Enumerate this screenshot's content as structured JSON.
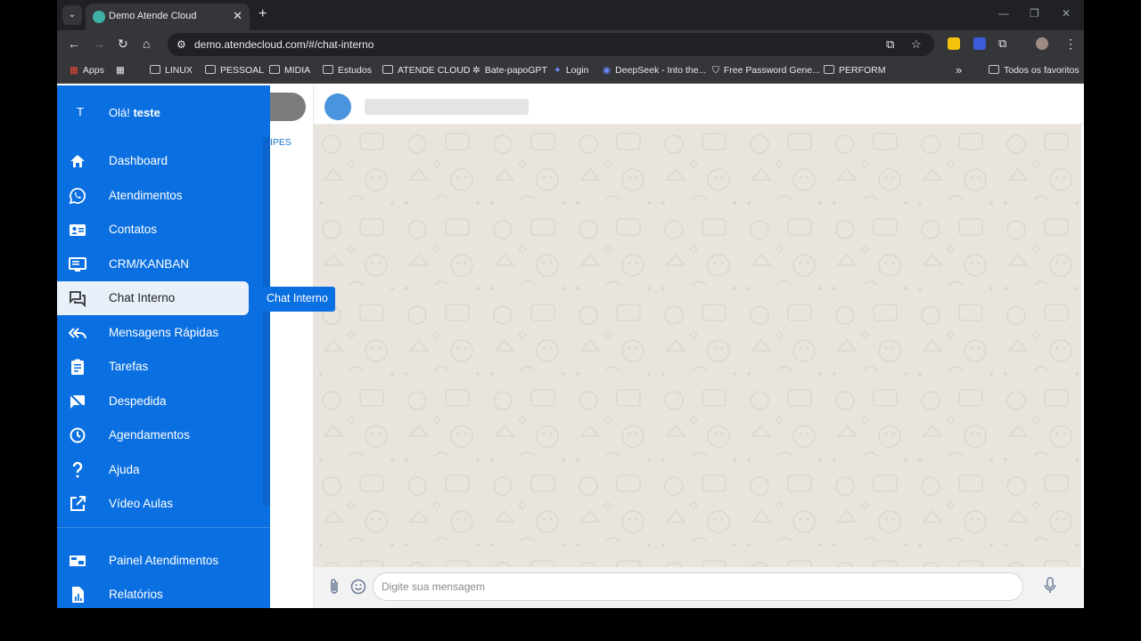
{
  "browser": {
    "tab_title": "Demo Atende Cloud",
    "tab_close": "✕",
    "tab_menu": "⌄",
    "new_tab": "+",
    "minimize": "—",
    "restore": "❐",
    "close": "✕",
    "url": "demo.atendecloud.com/#/chat-interno",
    "bookmarks": [
      {
        "label": "Apps"
      },
      {
        "label": "LINUX"
      },
      {
        "label": "PESSOAL"
      },
      {
        "label": "MIDIA"
      },
      {
        "label": "Estudos"
      },
      {
        "label": "ATENDE CLOUD"
      },
      {
        "label": "Bate-papoGPT"
      },
      {
        "label": "Login"
      },
      {
        "label": "DeepSeek - Into the..."
      },
      {
        "label": "Free Password Gene..."
      },
      {
        "label": "PERFORM"
      }
    ],
    "more_bookmarks": "»",
    "all_bookmarks": "Todos os favoritos"
  },
  "sidebar": {
    "avatar_letter": "T",
    "greeting": "Olá!",
    "user_name": "teste",
    "items": [
      {
        "label": "Dashboard",
        "icon": "home-icon"
      },
      {
        "label": "Atendimentos",
        "icon": "whatsapp-icon"
      },
      {
        "label": "Contatos",
        "icon": "contact-card-icon"
      },
      {
        "label": "CRM/KANBAN",
        "icon": "monitor-icon"
      },
      {
        "label": "Chat Interno",
        "icon": "forum-icon",
        "active": true
      },
      {
        "label": "Mensagens Rápidas",
        "icon": "reply-all-icon"
      },
      {
        "label": "Tarefas",
        "icon": "clipboard-icon"
      },
      {
        "label": "Despedida",
        "icon": "comment-off-icon"
      },
      {
        "label": "Agendamentos",
        "icon": "clock-icon"
      },
      {
        "label": "Ajuda",
        "icon": "help-icon"
      },
      {
        "label": "Vídeo Aulas",
        "icon": "open-in-new-icon"
      },
      {
        "label": "Painel Atendimentos",
        "icon": "dashboard-panel-icon"
      },
      {
        "label": "Relatórios",
        "icon": "report-icon"
      }
    ],
    "tooltip": "Chat Interno"
  },
  "list_panel": {
    "tab_label": "IPES"
  },
  "chat": {
    "input_placeholder": "Digite sua mensagem",
    "input_value": ""
  },
  "colors": {
    "sidebar_bg": "#0a6fe0",
    "chat_bg": "#e9e4de",
    "avatar": "#4a94de"
  }
}
